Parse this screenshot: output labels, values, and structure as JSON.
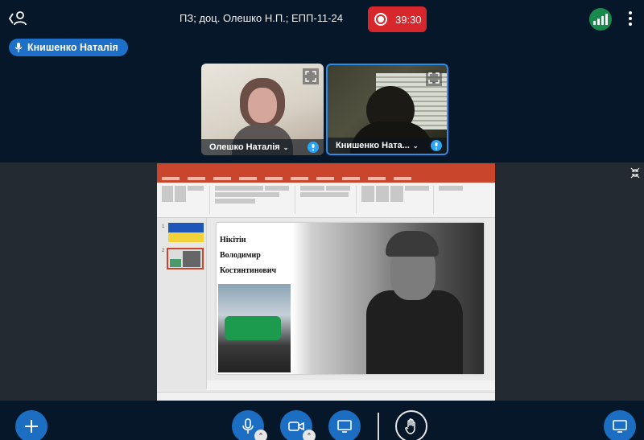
{
  "meeting": {
    "title": "ПЗ; доц. Олешко Н.П.; ЕПП-11-24",
    "recording_time": "39:30"
  },
  "talker": {
    "name": "Книшенко Наталія"
  },
  "webcams": [
    {
      "name": "Олешко Наталія"
    },
    {
      "name": "Книшенко Ната..."
    }
  ],
  "colors": {
    "background": "#06172a",
    "accent": "#1b6ec2",
    "record": "#d7262c",
    "connection": "#1a8a4c"
  },
  "icons": {
    "users": "user-icon",
    "record": "record-icon",
    "connection": "signal-bars-icon",
    "options": "kebab-menu-icon",
    "microphone": "microphone-icon",
    "camera": "camera-icon",
    "screen_share": "screen-share-icon",
    "raise_hand": "hand-icon",
    "actions": "plus-icon",
    "presentation": "presentation-icon",
    "fullscreen": "expand-icon"
  },
  "slide": {
    "text": [
      "Нікітін",
      "Володимир",
      "Костянтинович"
    ]
  }
}
